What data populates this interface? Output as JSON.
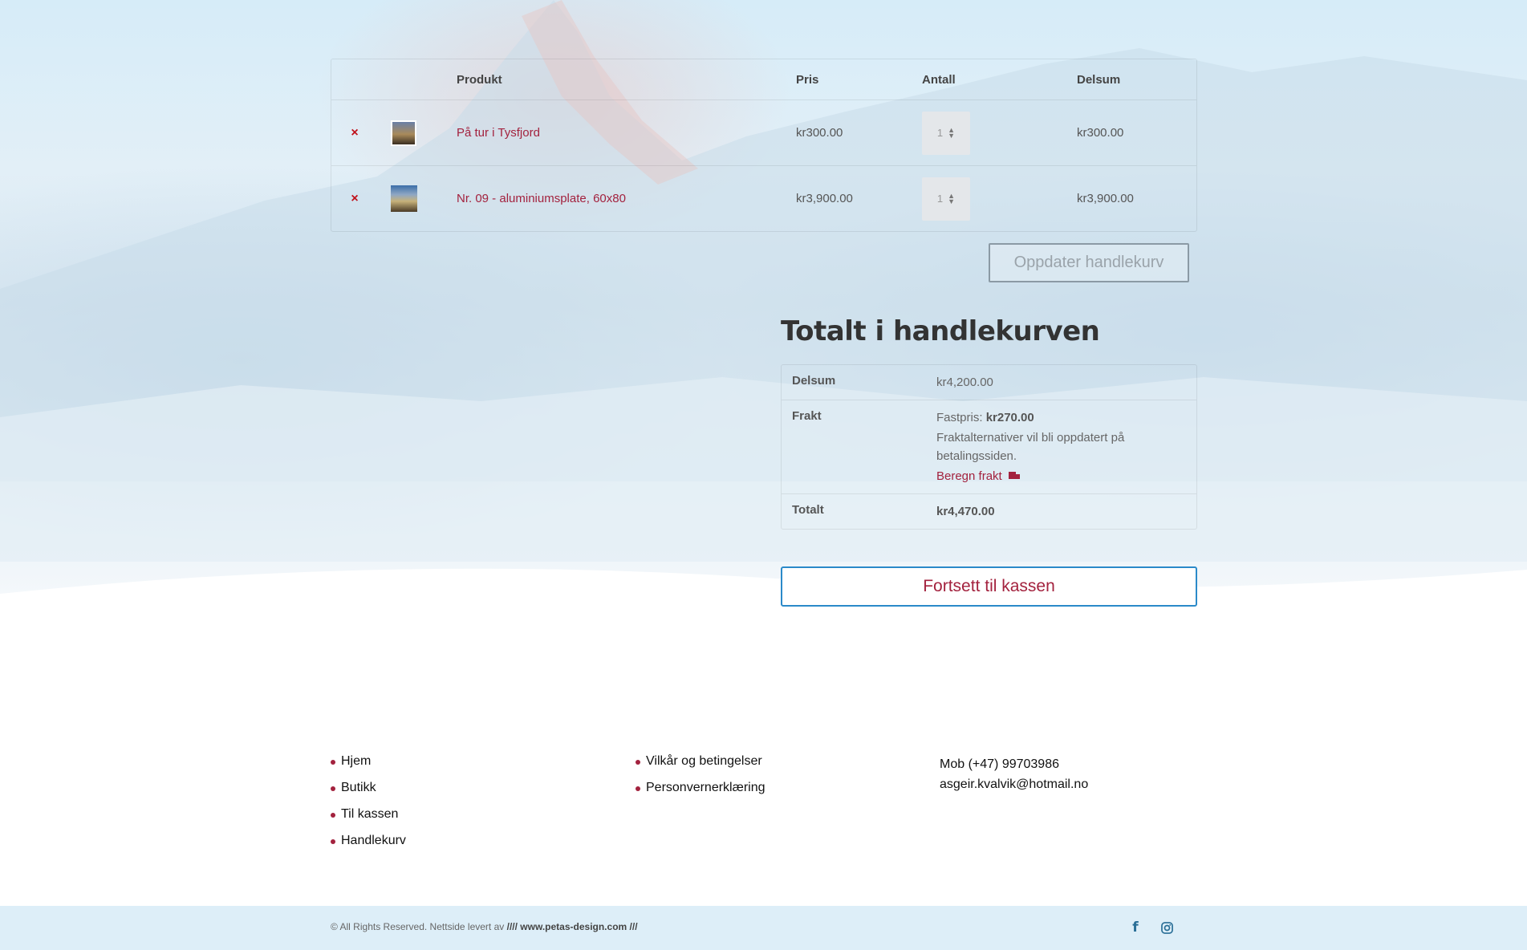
{
  "cart": {
    "headers": {
      "product": "Produkt",
      "price": "Pris",
      "quantity": "Antall",
      "subtotal": "Delsum"
    },
    "items": [
      {
        "remove": "×",
        "name": "På tur i Tysfjord",
        "price": "kr300.00",
        "qty": "1",
        "subtotal": "kr300.00"
      },
      {
        "remove": "×",
        "name": "Nr. 09 - aluminiumsplate, 60x80",
        "price": "kr3,900.00",
        "qty": "1",
        "subtotal": "kr3,900.00"
      }
    ],
    "update_label": "Oppdater handlekurv"
  },
  "totals": {
    "title": "Totalt i handlekurven",
    "subtotal_label": "Delsum",
    "subtotal_value": "kr4,200.00",
    "shipping_label": "Frakt",
    "shipping_method": "Fastpris:",
    "shipping_price": "kr270.00",
    "shipping_note": "Fraktalternativer vil bli oppdatert på betalingssiden.",
    "calc_shipping": "Beregn frakt",
    "total_label": "Totalt",
    "total_value": "kr4,470.00",
    "checkout_label": "Fortsett til kassen"
  },
  "footer": {
    "nav": [
      "Hjem",
      "Butikk",
      "Til kassen",
      "Handlekurv"
    ],
    "legal": [
      "Vilkår og betingelser",
      "Personvernerklæring"
    ],
    "phone": "Mob (+47) 99703986",
    "email": "asgeir.kvalvik@hotmail.no",
    "copyright_prefix": "© All Rights Reserved. Nettside levert av",
    "copyright_link": "//// www.petas-design.com ///",
    "social": {
      "facebook": "f",
      "instagram": "instagram-icon"
    }
  }
}
